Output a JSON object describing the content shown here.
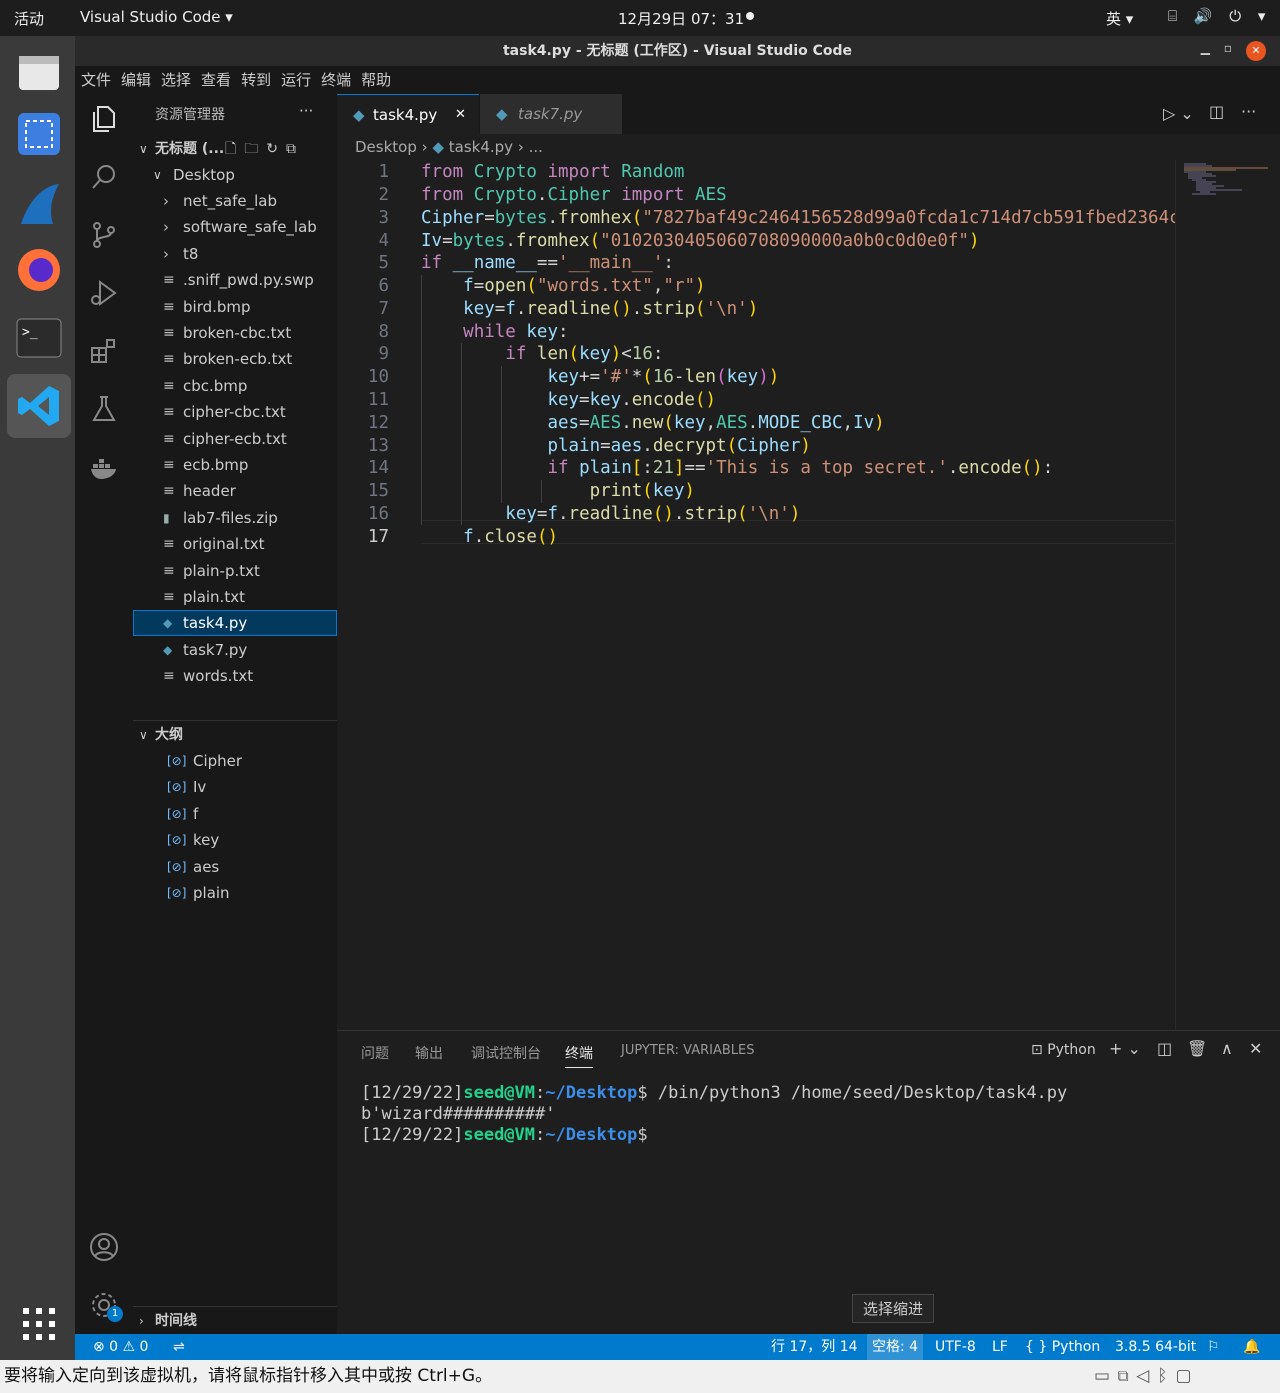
{
  "topbar": {
    "activities": "活动",
    "app_menu": "Visual Studio Code ▾",
    "clock": "12月29日  07：31",
    "lang": "英 ▾",
    "sys_icons": "⌸ 🔊 ⏻ ▾"
  },
  "window": {
    "title": "task4.py - 无标题 (工作区) - Visual Studio Code",
    "menu": [
      "文件",
      "编辑",
      "选择",
      "查看",
      "转到",
      "运行",
      "终端",
      "帮助"
    ]
  },
  "sidebar": {
    "title": "资源管理器",
    "more": "···",
    "workspace": "无标题 (...",
    "folder": "Desktop",
    "items": [
      {
        "label": "net_safe_lab",
        "kind": "folder"
      },
      {
        "label": "software_safe_lab",
        "kind": "folder"
      },
      {
        "label": "t8",
        "kind": "folder"
      },
      {
        "label": ".sniff_pwd.py.swp",
        "kind": "file"
      },
      {
        "label": "bird.bmp",
        "kind": "file"
      },
      {
        "label": "broken-cbc.txt",
        "kind": "file"
      },
      {
        "label": "broken-ecb.txt",
        "kind": "file"
      },
      {
        "label": "cbc.bmp",
        "kind": "file"
      },
      {
        "label": "cipher-cbc.txt",
        "kind": "file"
      },
      {
        "label": "cipher-ecb.txt",
        "kind": "file"
      },
      {
        "label": "ecb.bmp",
        "kind": "file"
      },
      {
        "label": "header",
        "kind": "file"
      },
      {
        "label": "lab7-files.zip",
        "kind": "zip"
      },
      {
        "label": "original.txt",
        "kind": "file"
      },
      {
        "label": "plain-p.txt",
        "kind": "file"
      },
      {
        "label": "plain.txt",
        "kind": "file"
      },
      {
        "label": "task4.py",
        "kind": "python",
        "selected": true
      },
      {
        "label": "task7.py",
        "kind": "python"
      },
      {
        "label": "words.txt",
        "kind": "file"
      }
    ],
    "outline_title": "大纲",
    "outline": [
      "Cipher",
      "Iv",
      "f",
      "key",
      "aes",
      "plain"
    ],
    "timeline_title": "时间线"
  },
  "tabs": [
    {
      "label": "task4.py",
      "active": true,
      "close": "✕"
    },
    {
      "label": "task7.py",
      "active": false
    }
  ],
  "breadcrumb": {
    "folder": "Desktop",
    "file": "task4.py",
    "tail": "..."
  },
  "code": {
    "line_numbers": [
      "1",
      "2",
      "3",
      "4",
      "5",
      "6",
      "7",
      "8",
      "9",
      "10",
      "11",
      "12",
      "13",
      "14",
      "15",
      "16",
      "17"
    ],
    "current_line": "17"
  },
  "panel": {
    "tabs": [
      "问题",
      "输出",
      "调试控制台",
      "终端",
      "JUPYTER: VARIABLES"
    ],
    "active_tab": "终端",
    "shell": "Python",
    "terminal": {
      "line1_time": "[12/29/22]",
      "user_host": "seed@VM",
      "path": "~/Desktop",
      "line1_cmd": "$ /bin/python3 /home/seed/Desktop/task4.py",
      "output": "b'wizard##########'",
      "line3_time": "[12/29/22]",
      "prompt_end": "$"
    }
  },
  "statusbar": {
    "errors": "⊗ 0",
    "warnings": "⚠ 0",
    "position": "行 17，列 14",
    "indent": "空格: 4",
    "encoding": "UTF-8",
    "eol": "LF",
    "language": "{ } Python",
    "interpreter": "3.8.5 64-bit"
  },
  "tooltip": "选择缩进",
  "vm_hint": "要将输入定向到该虚拟机，请将鼠标指针移入其中或按 Ctrl+G。",
  "colors": {
    "accent": "#007acc",
    "selection": "#04395e",
    "ubuntu_orange": "#e95420"
  }
}
